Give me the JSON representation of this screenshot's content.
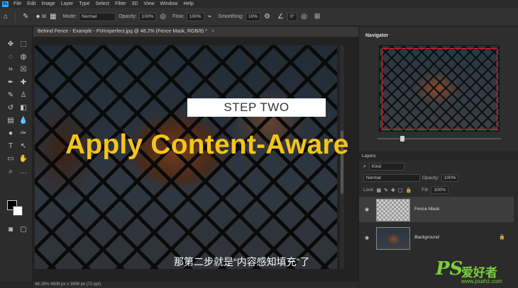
{
  "app": {
    "logo": "Ps"
  },
  "menu": [
    "File",
    "Edit",
    "Image",
    "Layer",
    "Type",
    "Select",
    "Filter",
    "3D",
    "View",
    "Window",
    "Help"
  ],
  "options_bar": {
    "brush_size": "30",
    "mode_label": "Mode:",
    "mode_value": "Normal",
    "opacity_label": "Opacity:",
    "opacity_value": "100%",
    "flow_label": "Flow:",
    "flow_value": "100%",
    "smoothing_label": "Smoothing:",
    "smoothing_value": "10%",
    "angle_value": "0°"
  },
  "document": {
    "tab_title": "Behind Fence - Example - PiXimperfect.jpg @ 48.2% (Fence Mask, RGB/8) *",
    "tab_close": "×"
  },
  "overlay": {
    "step": "STEP TWO",
    "headline": "Apply Content-Aware Fill",
    "subtitle": "那第二步就是“内容感知填充”了"
  },
  "status_bar": {
    "text": "48.18%    4608 px x 3456 px (72 ppi)"
  },
  "navigator": {
    "title": "Navigator"
  },
  "layers_panel": {
    "tab": "Layers",
    "filter_value": "Kind",
    "blend_mode": "Normal",
    "opacity_label": "Opacity:",
    "opacity_value": "100%",
    "lock_label": "Lock:",
    "fill_label": "Fill:",
    "fill_value": "100%",
    "layers": [
      {
        "name": "Fence Mask",
        "selected": true
      },
      {
        "name": "Background",
        "selected": false,
        "locked": true
      }
    ]
  },
  "watermark": {
    "logo": "PS",
    "chinese": "爱好者",
    "url": "www.psahz.com"
  },
  "colors": {
    "headline": "#f4c41b",
    "watermark": "#7ad03c",
    "nav_view_rect": "#e02020"
  }
}
